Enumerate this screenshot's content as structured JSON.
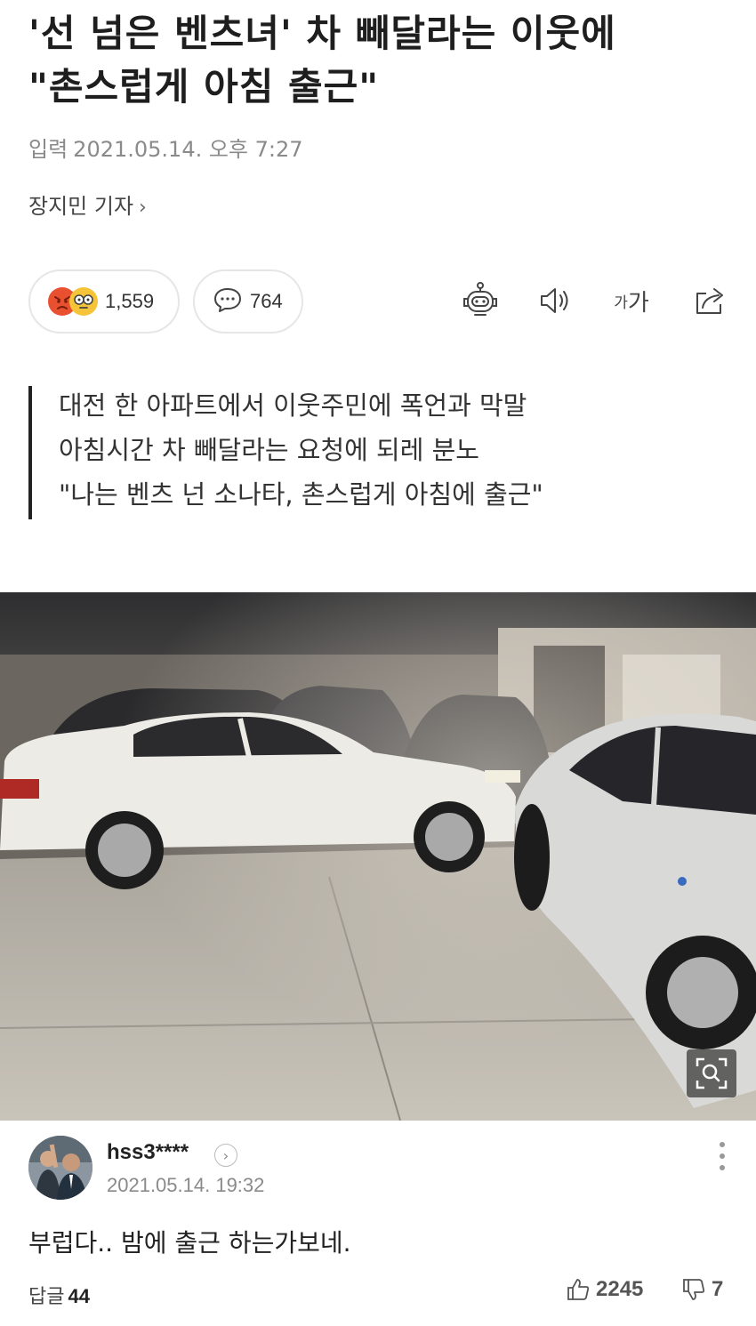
{
  "article": {
    "headline_line1": "'선 넘은 벤츠녀' 차 빼달라는 이웃에",
    "headline_line2": "\"촌스럽게 아침 출근\"",
    "date_label": "입력",
    "date_value": "2021.05.14. 오후 7:27",
    "reporter": "장지민 기자",
    "reporter_chevron": "›"
  },
  "reactions": {
    "count": "1,559",
    "icons": [
      "angry-emoji-icon",
      "glasses-emoji-icon"
    ],
    "comment_count": "764"
  },
  "toolbar": {
    "items": [
      "robot-summary-icon",
      "speaker-icon",
      "font-size-icon",
      "share-icon"
    ],
    "font_size_small": "가",
    "font_size_large": "가"
  },
  "summary": {
    "lines": [
      "대전 한 아파트에서 이웃주민에 폭언과 막말",
      "아침시간 차 빼달라는 요청에 되레 분노",
      "\"나는 벤츠 넌 소나타, 촌스럽게 아침에 출근\""
    ]
  },
  "photo": {
    "subject": "white sedans parked in underground garage",
    "zoom_icon": "zoom-search-icon"
  },
  "comment": {
    "username": "hss3****",
    "timestamp": "2021.05.14. 19:32",
    "text": "부럽다.. 밤에 출근 하는가보네.",
    "replies_label": "답글",
    "replies_count": "44",
    "likes": "2245",
    "dislikes": "7"
  },
  "colors": {
    "headline": "#1e1e1e",
    "meta": "#8a8a8a",
    "border": "#e6e6e6",
    "angry": "#e8502f",
    "glasses": "#f5c438"
  }
}
